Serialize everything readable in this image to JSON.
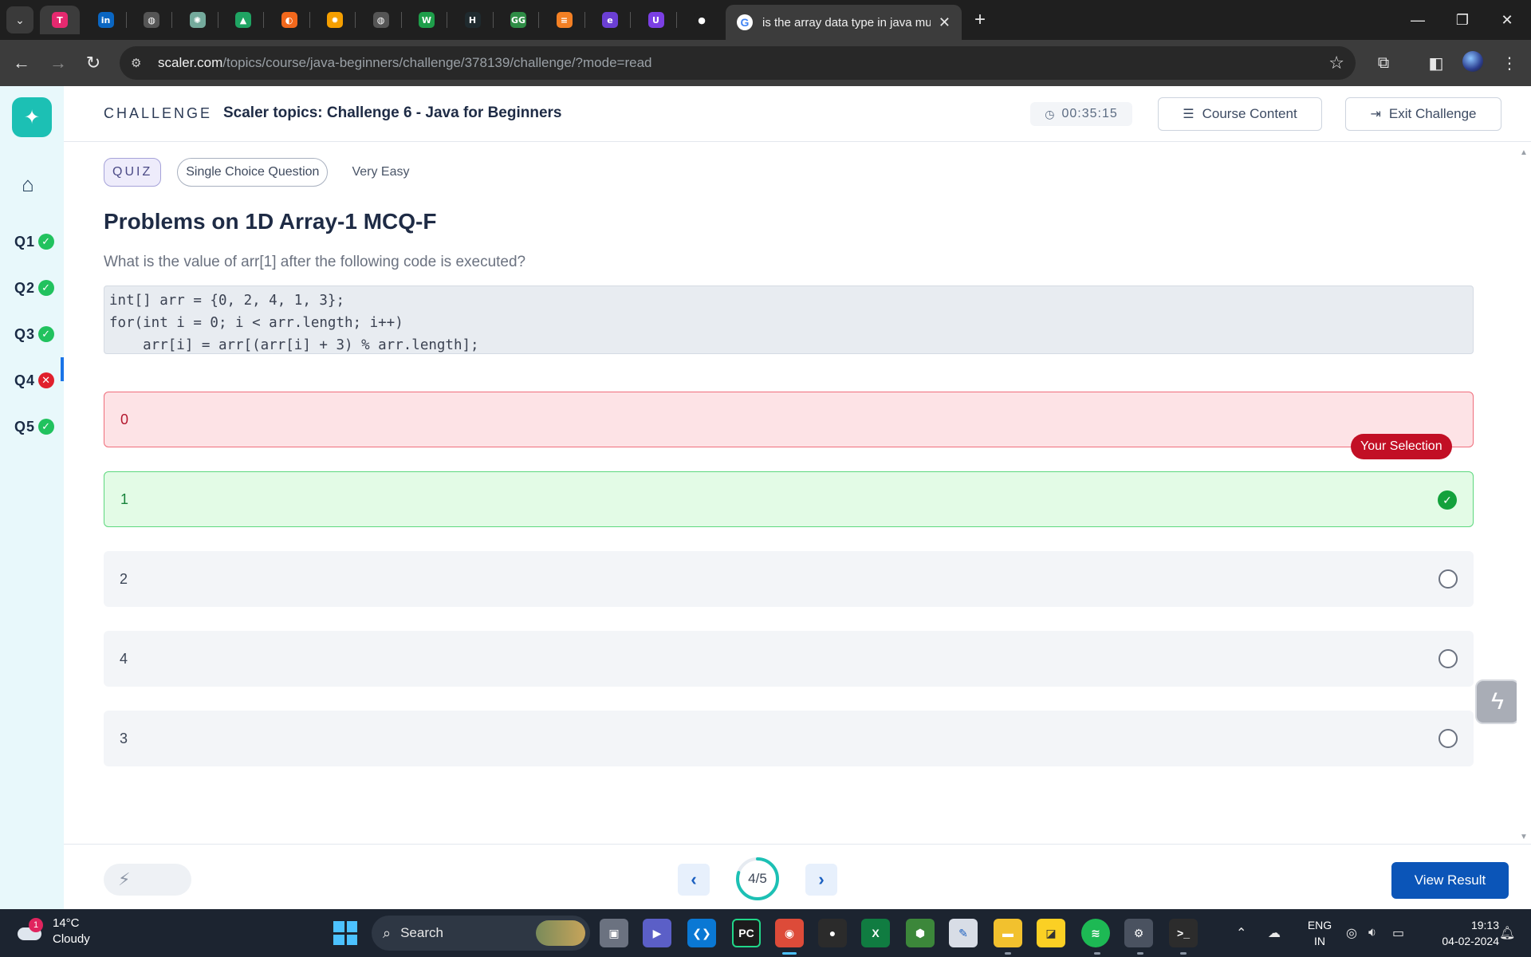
{
  "browser": {
    "pinned_tabs": [
      {
        "icon": "typeform-icon",
        "letter": "T",
        "color": "#e6296f"
      },
      {
        "icon": "linkedin-icon",
        "letter": "in",
        "color": "#0a66c2"
      },
      {
        "icon": "globe-icon",
        "letter": "◍",
        "color": "#555555"
      },
      {
        "icon": "chatgpt-icon",
        "letter": "✺",
        "color": "#74aa9c"
      },
      {
        "icon": "google-drive-icon",
        "letter": "▲",
        "color": "#1fa463"
      },
      {
        "icon": "codepen-icon",
        "letter": "◐",
        "color": "#f2681c"
      },
      {
        "icon": "sun-icon",
        "letter": "✹",
        "color": "#f59f00"
      },
      {
        "icon": "globe-icon",
        "letter": "◍",
        "color": "#555555"
      },
      {
        "icon": "w-icon",
        "letter": "W",
        "color": "#1e9e4a"
      },
      {
        "icon": "hackerrank-icon",
        "letter": "H",
        "color": "#1f2a2e"
      },
      {
        "icon": "geeksforgeeks-icon",
        "letter": "GG",
        "color": "#2f8d46"
      },
      {
        "icon": "stackoverflow-icon",
        "letter": "≡",
        "color": "#f48024"
      },
      {
        "icon": "e-icon",
        "letter": "e",
        "color": "#6b3fd4"
      },
      {
        "icon": "u-icon",
        "letter": "U",
        "color": "#7b3fe4"
      },
      {
        "icon": "github-icon",
        "letter": "●",
        "color": "#1f1f1f"
      }
    ],
    "active_tab_title": "is the array data type in java mu",
    "new_tab_label": "+",
    "url_host": "scaler.com",
    "url_path": "/topics/course/java-beginners/challenge/378139/challenge/?mode=read"
  },
  "header": {
    "challenge_label": "CHALLENGE",
    "title": "Scaler topics: Challenge 6 - Java for Beginners",
    "timer": "00:35:15",
    "course_content_label": "Course Content",
    "exit_label": "Exit Challenge"
  },
  "rail": {
    "questions": [
      {
        "label": "Q1",
        "status": "correct"
      },
      {
        "label": "Q2",
        "status": "correct"
      },
      {
        "label": "Q3",
        "status": "correct"
      },
      {
        "label": "Q4",
        "status": "wrong"
      },
      {
        "label": "Q5",
        "status": "correct"
      }
    ]
  },
  "question": {
    "tag_quiz": "QUIZ",
    "tag_type": "Single Choice Question",
    "difficulty": "Very Easy",
    "title": "Problems on 1D Array-1 MCQ-F",
    "prompt": "What is the value of arr[1] after the following code is executed?",
    "code": "int[] arr = {0, 2, 4, 1, 3};\nfor(int i = 0; i < arr.length; i++)\n    arr[i] = arr[(arr[i] + 3) % arr.length];",
    "options": [
      {
        "label": "0",
        "state": "wrong"
      },
      {
        "label": "1",
        "state": "correct"
      },
      {
        "label": "2",
        "state": "neutral"
      },
      {
        "label": "4",
        "state": "neutral"
      },
      {
        "label": "3",
        "state": "neutral"
      }
    ],
    "selection_badge": "Your Selection"
  },
  "footer": {
    "progress_text": "4/5",
    "progress_fraction": 0.8,
    "view_result_label": "View Result"
  },
  "taskbar": {
    "weather_temp": "14°C",
    "weather_cond": "Cloudy",
    "weather_badge": "1",
    "search_label": "Search",
    "lang_line1": "ENG",
    "lang_line2": "IN",
    "time": "19:13",
    "date": "04-02-2024"
  },
  "colors": {
    "accent": "#0b55b8",
    "teal": "#1cc0b4",
    "correct": "#21c25e",
    "wrong": "#e0202c"
  }
}
